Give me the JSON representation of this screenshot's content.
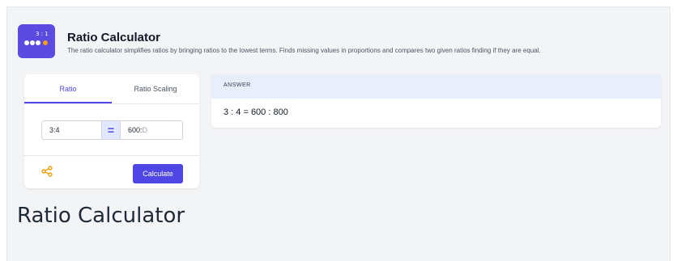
{
  "header": {
    "logo_text": "3 : 1",
    "title": "Ratio Calculator",
    "subtitle": "The ratio calculator simplifies ratios by bringing ratios to the lowest terms. Finds missing values in proportions and compares two given ratios finding if they are equal."
  },
  "tabs": [
    {
      "label": "Ratio",
      "active": true
    },
    {
      "label": "Ratio Scaling",
      "active": false
    }
  ],
  "form": {
    "left_value": "3:4",
    "right_value": "600:",
    "right_placeholder_part": "D",
    "equals": "="
  },
  "actions": {
    "share_icon": "share-icon",
    "calculate_label": "Calculate"
  },
  "answer": {
    "heading": "ANSWER",
    "result": "3 : 4 = 600 : 800"
  },
  "page_heading": "Ratio Calculator",
  "colors": {
    "accent": "#4f46e5",
    "logo_bg": "#5b4be0",
    "share": "#f59e0b",
    "answer_head_bg": "#e8eefb",
    "frame_bg": "#f3f4f6"
  }
}
